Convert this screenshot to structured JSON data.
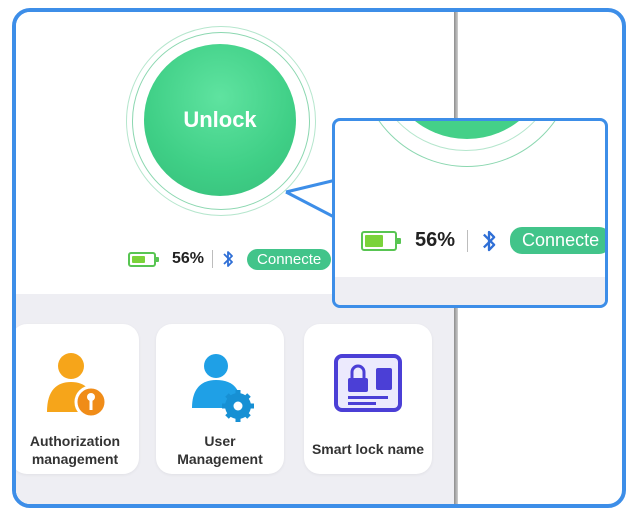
{
  "app": {
    "unlock_label": "Unlock",
    "battery_percent": "56%",
    "battery_level": 0.56,
    "connection_status": "Connecte",
    "accent_green": "#3fcf86",
    "callout_border": "#3d8ee8"
  },
  "tiles": [
    {
      "label": "Authorization\nmanagement",
      "icon": "authorization-key-user-icon"
    },
    {
      "label": "User\nManagement",
      "icon": "user-settings-icon"
    },
    {
      "label": "Smart lock name",
      "icon": "id-card-lock-icon"
    }
  ],
  "zoom_callout": {
    "battery_percent": "56%",
    "connection_status": "Connecte"
  }
}
